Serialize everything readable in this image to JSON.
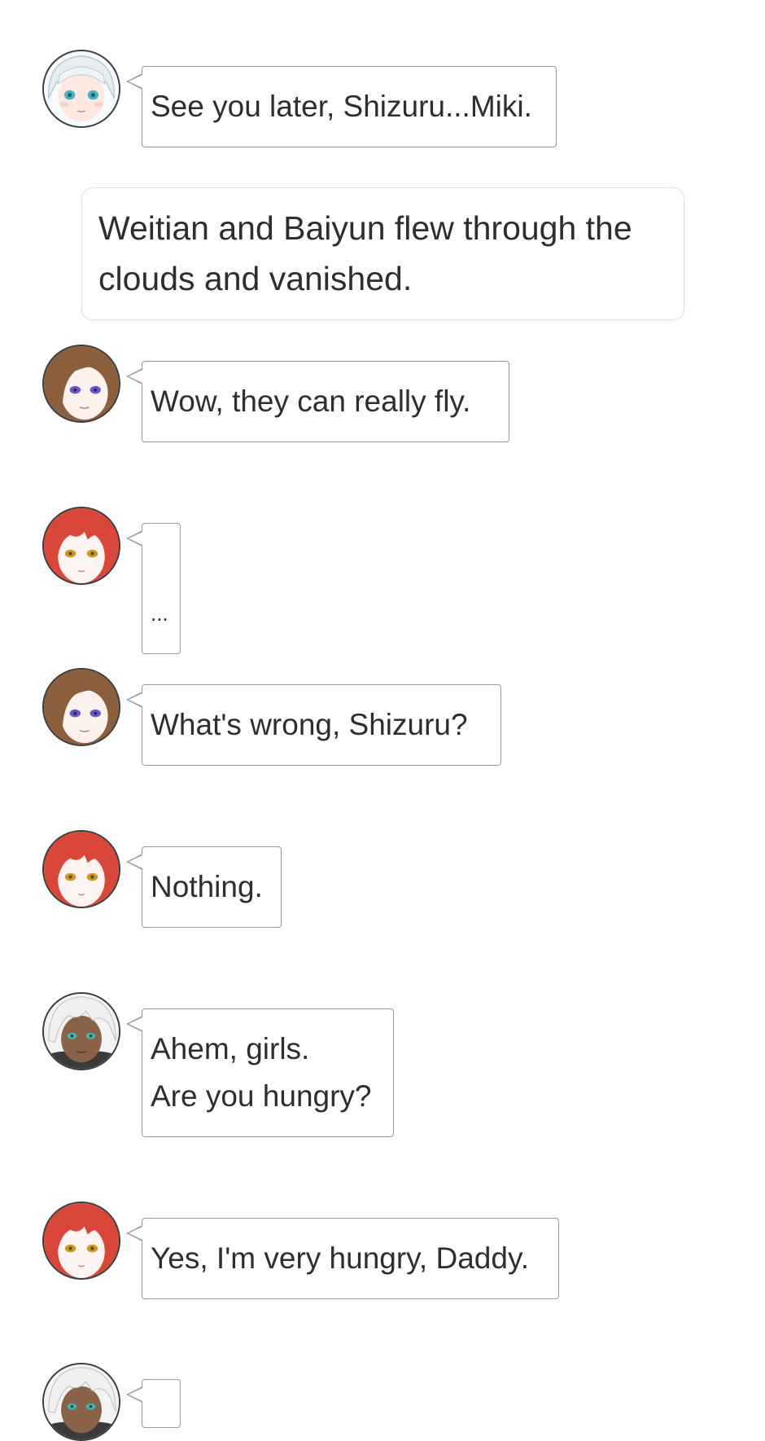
{
  "narration": "Weitian and Baiyun flew through the clouds and vanished.",
  "messages": [
    {
      "speaker_icon": "silver-haired-girl-avatar",
      "text": "See you later, Shizuru...Miki."
    },
    {
      "speaker_icon": "brown-haired-girl-avatar",
      "text": "Wow, they can really fly."
    },
    {
      "speaker_icon": "red-haired-girl-avatar",
      "text": "..."
    },
    {
      "speaker_icon": "brown-haired-girl-avatar",
      "text": "What's wrong, Shizuru?"
    },
    {
      "speaker_icon": "red-haired-girl-avatar",
      "text": "Nothing."
    },
    {
      "speaker_icon": "white-haired-man-avatar",
      "text": "Ahem, girls.\nAre you hungry?"
    },
    {
      "speaker_icon": "red-haired-girl-avatar",
      "text": "Yes, I'm very hungry, Daddy."
    },
    {
      "speaker_icon": "white-haired-man-avatar",
      "text": ""
    }
  ],
  "colors": {
    "bubble_border": "#9a9a9a",
    "text": "#2e2e2e",
    "red_hair": "#d9473a",
    "brown_hair": "#8b5e3c",
    "silver_hair": "#e6eef2",
    "white_hair": "#f0f0f0"
  }
}
